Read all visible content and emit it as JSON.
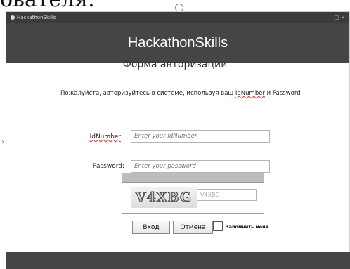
{
  "document": {
    "text_fragment": "ователя."
  },
  "window": {
    "title": "HackathonSkills",
    "controls": [
      "–",
      "□",
      "×"
    ]
  },
  "header": {
    "title": "HackathonSkills"
  },
  "form": {
    "title": "Форма авторизации",
    "instruction_before": "Пожалуйста, авторизуйтесь в системе, используя ваш ",
    "instruction_id": "IdNumber",
    "instruction_after": " и Password",
    "id_label": "IdNumber",
    "id_label_suffix": ":",
    "id_placeholder": "Enter your IdNumber",
    "password_label": "Password:",
    "password_placeholder": "Enter your password"
  },
  "captcha": {
    "image_text": "V4XBG",
    "input_value": "V4XBG"
  },
  "buttons": {
    "login": "Вход",
    "cancel": "Отмена",
    "remember": "Запомнить меня"
  },
  "colors": {
    "header_bg": "#454545",
    "titlebar_bg": "#3b3b3b",
    "spellcheck": "#d33"
  }
}
